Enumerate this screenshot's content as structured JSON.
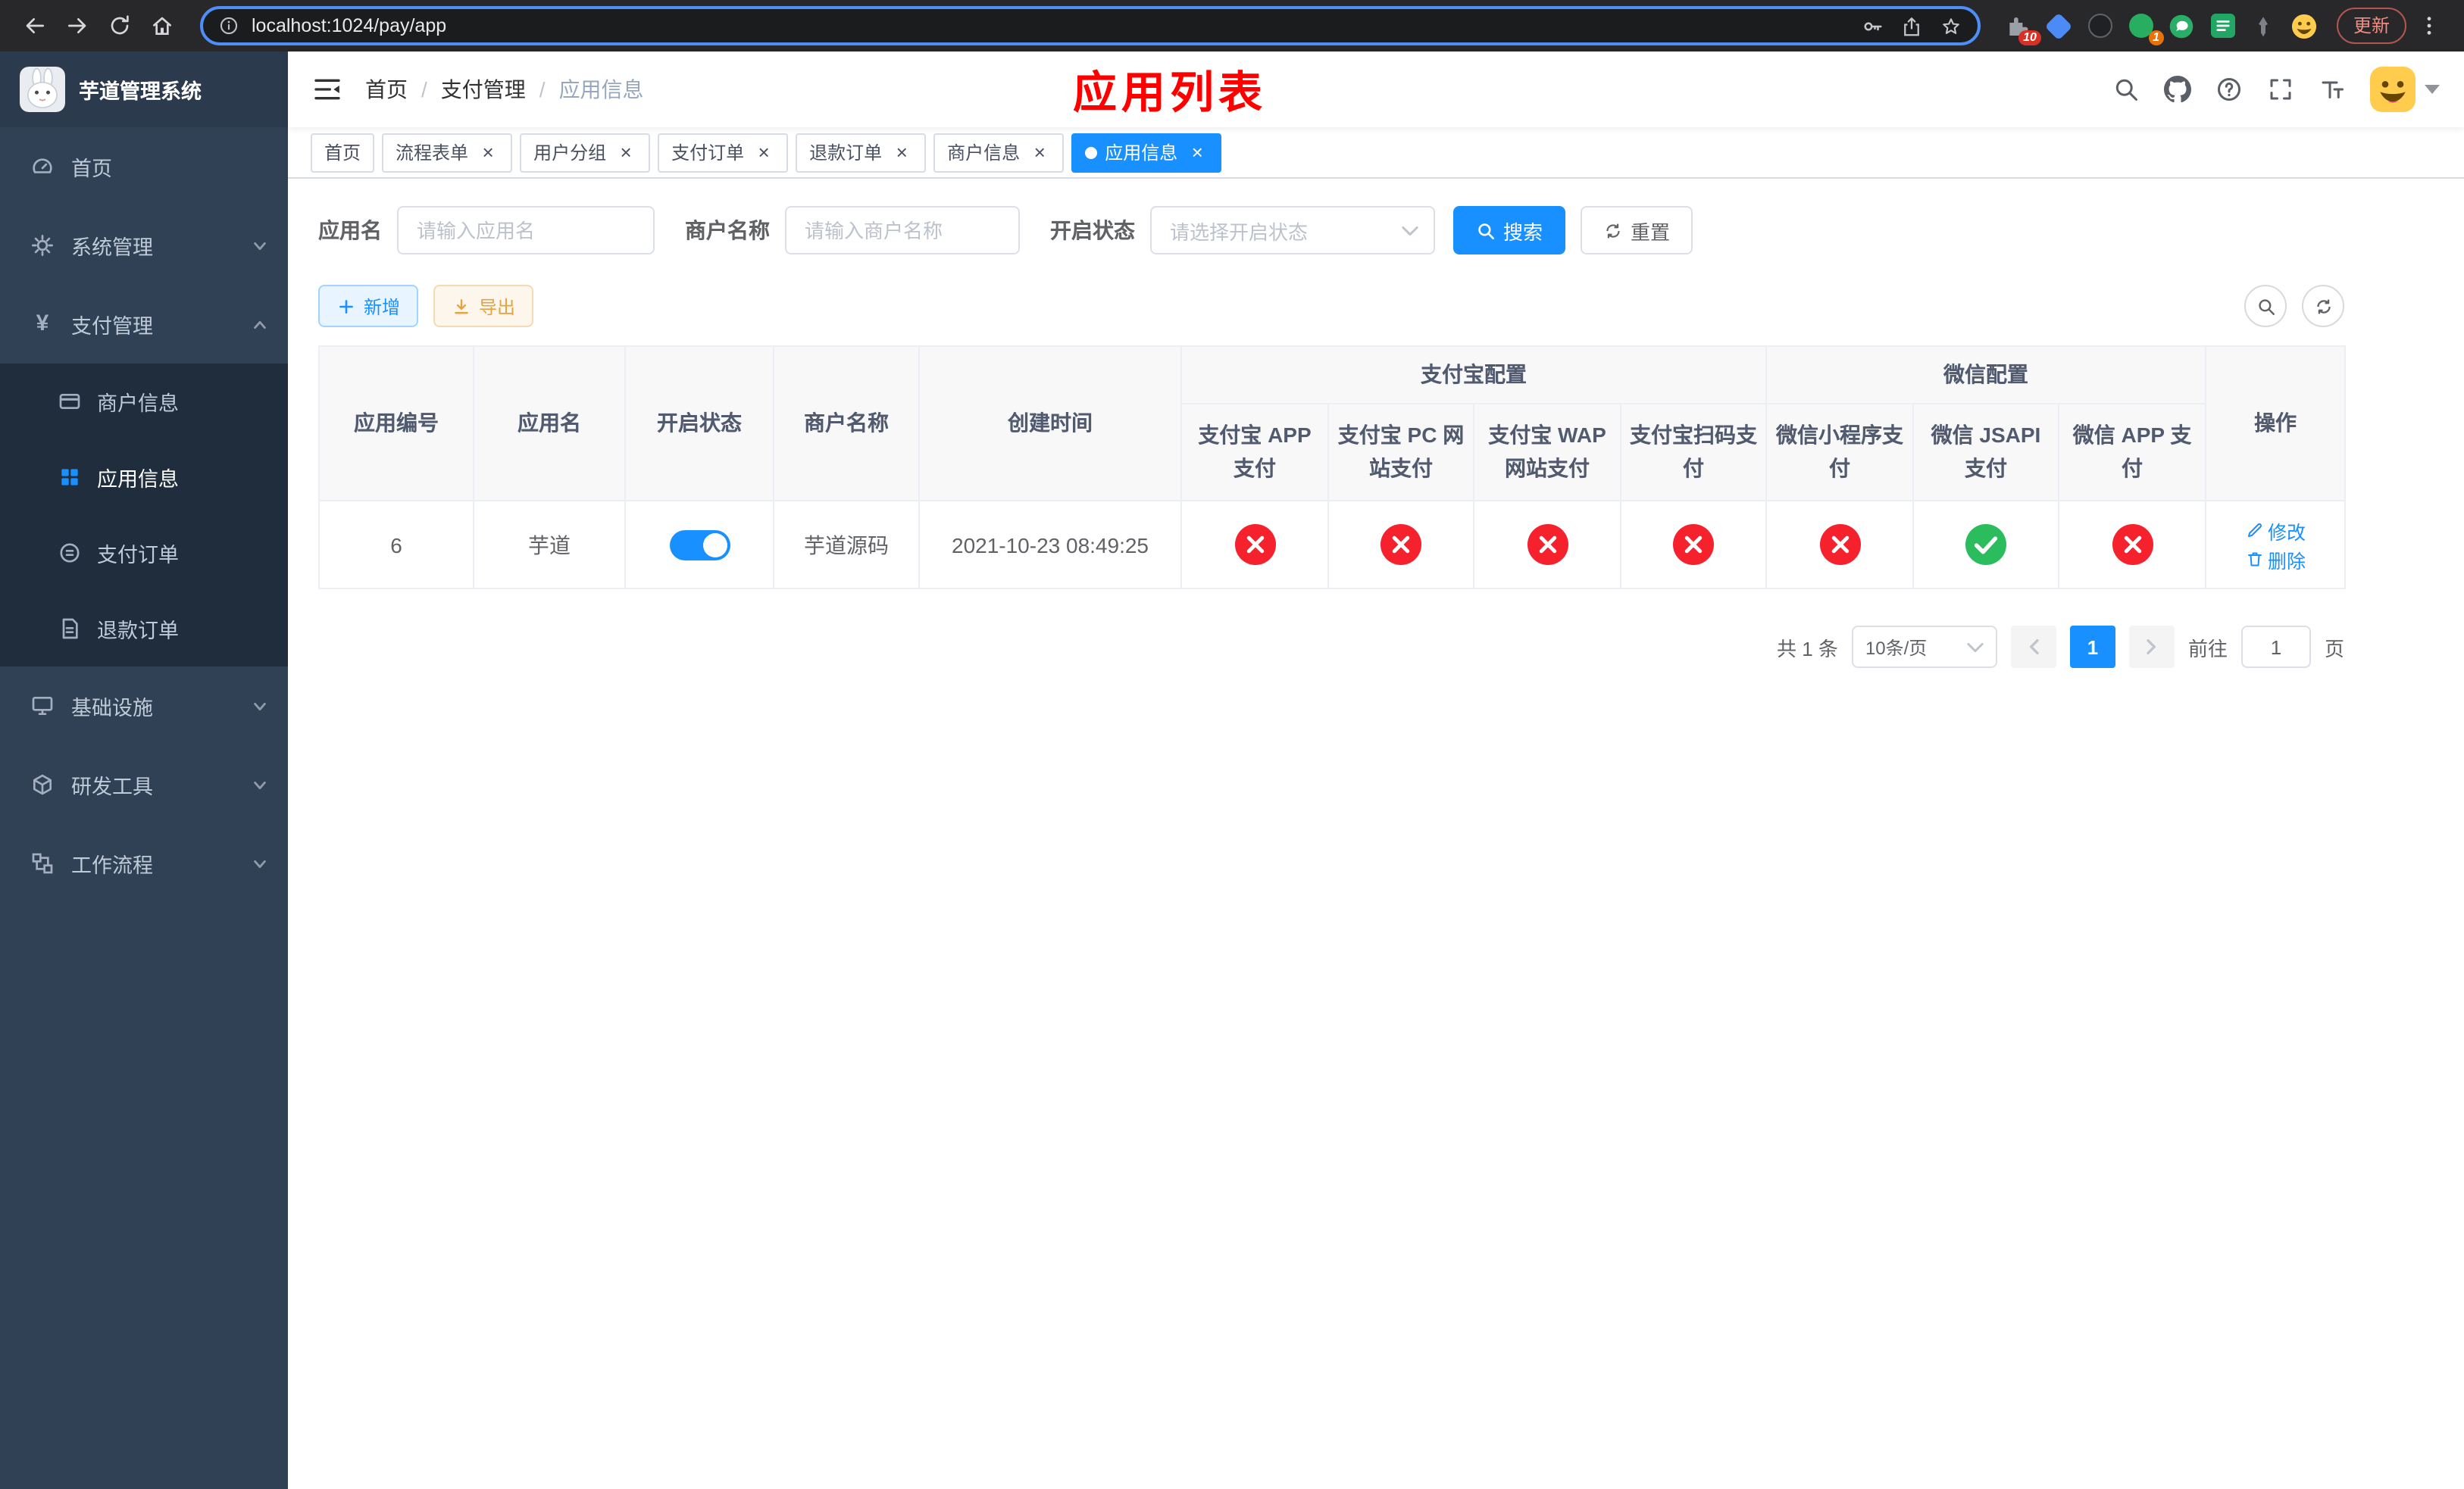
{
  "colors": {
    "primary": "#1890ff",
    "danger": "#f5222d",
    "success": "#2bbd5d",
    "sidebar_bg": "#304156",
    "submenu_bg": "#1f2d3d",
    "page_title_red": "#ff0000"
  },
  "icons": {
    "search": "magnifier",
    "reset": "refresh-arrows",
    "add": "plus",
    "export": "download-arrow",
    "edit": "pencil",
    "delete": "trash",
    "enabled": "check-circle",
    "disabled": "close-circle"
  },
  "browser": {
    "url": "localhost:1024/pay/app",
    "update_label": "更新",
    "extension_badges": {
      "proxy": "10",
      "avatar": "1"
    }
  },
  "sidebar": {
    "logo_title": "芋道管理系统",
    "menu": [
      {
        "label": "首页"
      },
      {
        "label": "系统管理"
      },
      {
        "label": "支付管理"
      },
      {
        "label": "商户信息"
      },
      {
        "label": "应用信息"
      },
      {
        "label": "支付订单"
      },
      {
        "label": "退款订单"
      },
      {
        "label": "基础设施"
      },
      {
        "label": "研发工具"
      },
      {
        "label": "工作流程"
      }
    ]
  },
  "navbar": {
    "breadcrumb": {
      "home": "首页",
      "section": "支付管理",
      "current": "应用信息",
      "separator": "/"
    },
    "page_title": "应用列表"
  },
  "tabs": {
    "items": [
      {
        "label": "首页",
        "closable": false,
        "active": false
      },
      {
        "label": "流程表单",
        "closable": true,
        "active": false
      },
      {
        "label": "用户分组",
        "closable": true,
        "active": false
      },
      {
        "label": "支付订单",
        "closable": true,
        "active": false
      },
      {
        "label": "退款订单",
        "closable": true,
        "active": false
      },
      {
        "label": "商户信息",
        "closable": true,
        "active": false
      },
      {
        "label": "应用信息",
        "closable": true,
        "active": true
      }
    ]
  },
  "filters": {
    "app_name": {
      "label": "应用名",
      "placeholder": "请输入应用名"
    },
    "merchant_name": {
      "label": "商户名称",
      "placeholder": "请输入商户名称"
    },
    "status": {
      "label": "开启状态",
      "placeholder": "请选择开启状态"
    },
    "search_button": "搜索",
    "reset_button": "重置"
  },
  "toolbar": {
    "add_button": "新增",
    "export_button": "导出"
  },
  "table": {
    "group_headers": {
      "alipay": "支付宝配置",
      "wechat": "微信配置"
    },
    "columns": {
      "app_id": "应用编号",
      "app_name": "应用名",
      "status": "开启状态",
      "merchant_name": "商户名称",
      "create_time": "创建时间",
      "alipay_app": "支付宝 APP 支付",
      "alipay_pc": "支付宝 PC 网站支付",
      "alipay_wap": "支付宝 WAP 网站支付",
      "alipay_qr": "支付宝扫码支付",
      "wechat_lite": "微信小程序支付",
      "wechat_jsapi": "微信 JSAPI 支付",
      "wechat_app": "微信 APP 支付",
      "actions": "操作"
    },
    "rows": [
      {
        "app_id": "6",
        "app_name": "芋道",
        "enabled": true,
        "merchant_name": "芋道源码",
        "create_time": "2021-10-23 08:49:25",
        "pay_configs": [
          false,
          false,
          false,
          false,
          false,
          true,
          false
        ],
        "edit_label": "修改",
        "delete_label": "删除"
      }
    ]
  },
  "pagination": {
    "total": "共 1 条",
    "page_size": "10条/页",
    "current_page": "1",
    "goto_label": "前往",
    "goto_value": "1",
    "goto_suffix": "页"
  }
}
